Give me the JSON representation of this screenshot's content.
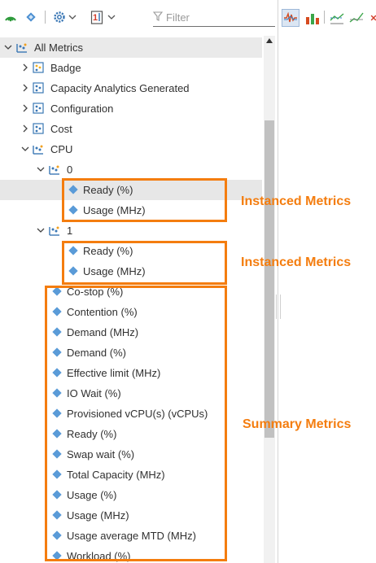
{
  "toolbar": {
    "filter_placeholder": "Filter",
    "icons": [
      "signal-icon",
      "diamond-layers-icon",
      "gear-icon",
      "chevron-down-icon",
      "sort-one-icon",
      "chevron-down-icon",
      "filter-icon"
    ]
  },
  "right_toolbar": {
    "icons": [
      "waveform-icon",
      "bar-chart-icon",
      "line-chart-icon",
      "trend-chart-icon",
      "close-icon"
    ]
  },
  "tree": {
    "root": {
      "label": "All Metrics"
    },
    "groups": [
      {
        "label": "Badge"
      },
      {
        "label": "Capacity Analytics Generated"
      },
      {
        "label": "Configuration"
      },
      {
        "label": "Cost"
      },
      {
        "label": "CPU"
      }
    ],
    "instance0": {
      "label": "0",
      "metrics": [
        "Ready (%)",
        "Usage (MHz)"
      ]
    },
    "instance1": {
      "label": "1",
      "metrics": [
        "Ready (%)",
        "Usage (MHz)"
      ]
    },
    "summary_metrics": [
      "Co-stop (%)",
      "Contention (%)",
      "Demand (MHz)",
      "Demand (%)",
      "Effective limit (MHz)",
      "IO Wait (%)",
      "Provisioned vCPU(s) (vCPUs)",
      "Ready (%)",
      "Swap wait (%)",
      "Total Capacity (MHz)",
      "Usage (%)",
      "Usage (MHz)",
      "Usage average MTD (MHz)",
      "Workload (%)"
    ]
  },
  "annotations": {
    "instanced_0": "Instanced Metrics",
    "instanced_1": "Instanced Metrics",
    "summary": "Summary Metrics"
  },
  "colors": {
    "annotation": "#f47d0f",
    "diamond": "#5a9bd8",
    "selected_row": "#e7e7e7"
  }
}
